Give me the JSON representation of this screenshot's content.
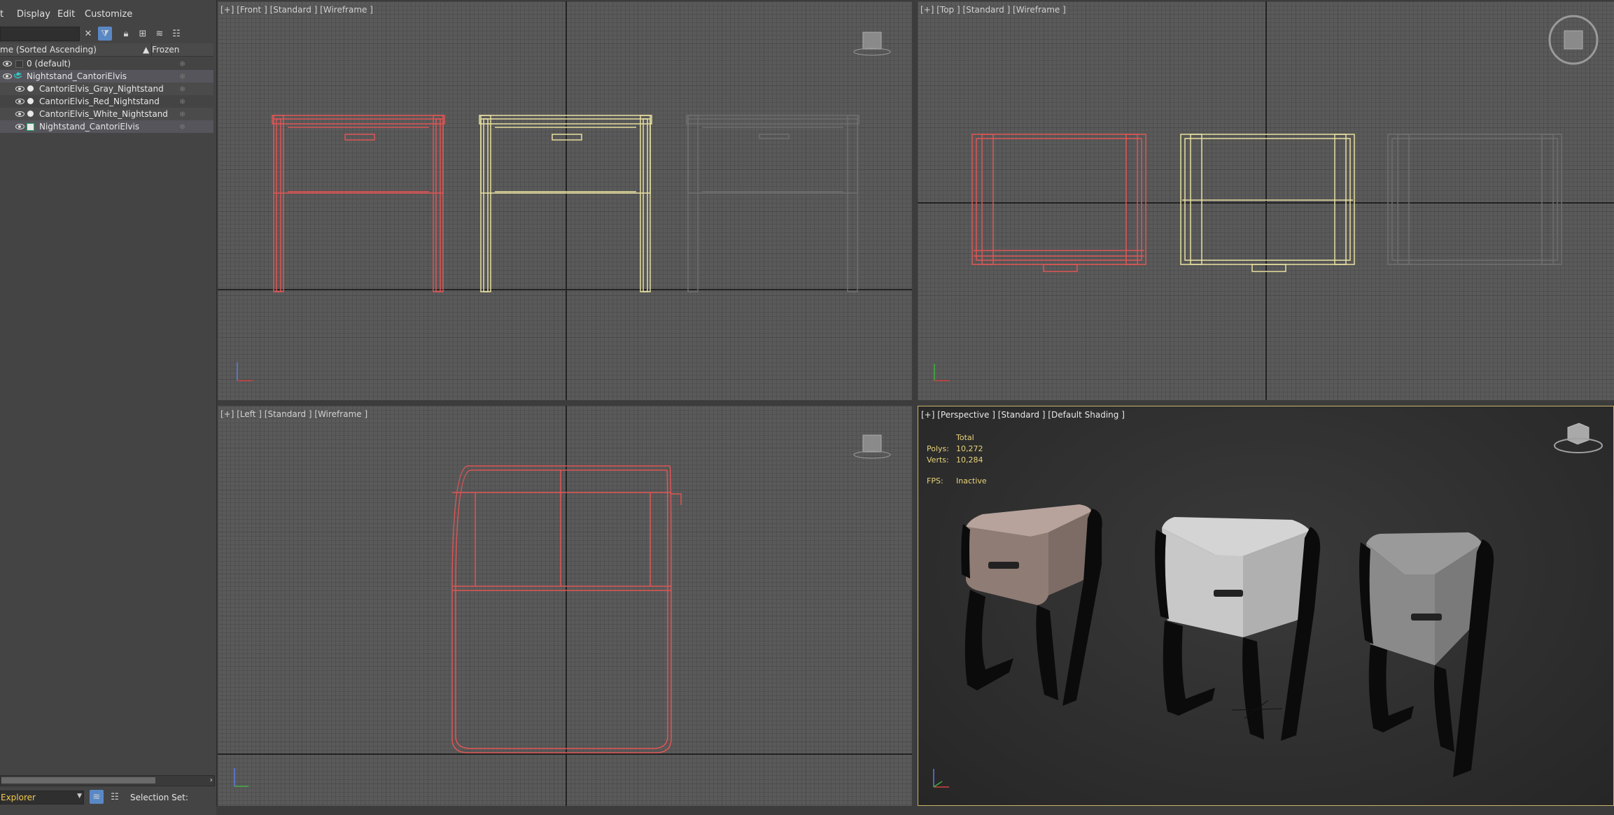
{
  "menubar": {
    "items": [
      "t",
      "Display",
      "Edit",
      "Customize"
    ]
  },
  "explorer": {
    "columns": {
      "name": "me (Sorted Ascending)",
      "frozen": "▲ Frozen"
    },
    "rows": [
      {
        "label": "0 (default)",
        "indent": 1
      },
      {
        "label": "Nightstand_CantoriElvis",
        "indent": 1
      },
      {
        "label": "CantoriElvis_Gray_Nightstand",
        "indent": 2
      },
      {
        "label": "CantoriElvis_Red_Nightstand",
        "indent": 2
      },
      {
        "label": "CantoriElvis_White_Nightstand",
        "indent": 2
      },
      {
        "label": "Nightstand_CantoriElvis",
        "indent": 2
      }
    ],
    "bottom": {
      "explorer_label": "Explorer",
      "selection_set_label": "Selection Set:"
    }
  },
  "viewports": {
    "front": {
      "label": "[+] [Front ] [Standard ] [Wireframe ]"
    },
    "top": {
      "label": "[+] [Top ] [Standard ] [Wireframe ]"
    },
    "left": {
      "label": "[+] [Left ] [Standard ] [Wireframe ]"
    },
    "persp": {
      "label": "[+] [Perspective ] [Standard ] [Default Shading ]"
    }
  },
  "stats": {
    "total_label": "Total",
    "polys_label": "Polys:",
    "polys_value": "10,272",
    "verts_label": "Verts:",
    "verts_value": "10,284",
    "fps_label": "FPS:",
    "fps_value": "Inactive"
  },
  "colors": {
    "red": "#e05555",
    "yellow": "#e8e0a0",
    "gray": "#6e6e6e",
    "accent": "#5a88c5"
  }
}
